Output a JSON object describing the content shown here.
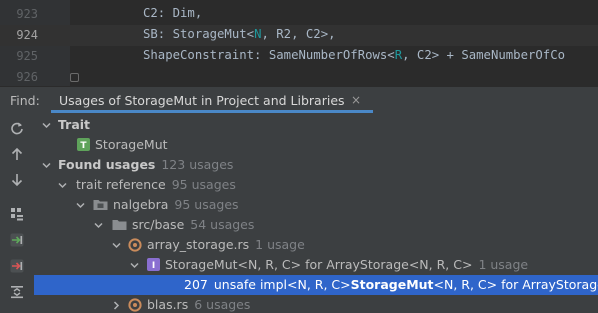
{
  "editor": {
    "lines": [
      {
        "number": "923",
        "segments": [
          {
            "text": "C2: Dim,",
            "cls": ""
          }
        ]
      },
      {
        "number": "924",
        "segments": [
          {
            "text": "SB: StorageMut<",
            "cls": ""
          },
          {
            "text": "N",
            "cls": "gen"
          },
          {
            "text": ", R2, C2>,",
            "cls": ""
          }
        ]
      },
      {
        "number": "925",
        "segments": [
          {
            "text": "ShapeConstraint: SameNumberOfRows<",
            "cls": ""
          },
          {
            "text": "R",
            "cls": "gen"
          },
          {
            "text": ", C2> + SameNumberOfCo",
            "cls": ""
          }
        ]
      },
      {
        "number": "926",
        "segments": []
      }
    ]
  },
  "find": {
    "label": "Find:",
    "tab_title": "Usages of StorageMut in Project and Libraries",
    "close_glyph": "×"
  },
  "tree": {
    "trait_header": "Trait",
    "trait_item": "StorageMut",
    "trait_icon_letter": "T",
    "found_usages": "Found usages",
    "found_usages_count": "123 usages",
    "trait_reference": "trait reference",
    "trait_reference_count": "95 usages",
    "nalgebra": "nalgebra",
    "nalgebra_count": "95 usages",
    "src_base": "src/base",
    "src_base_count": "54 usages",
    "array_storage": "array_storage.rs",
    "array_storage_count": "1 usage",
    "impl_label": "StorageMut<N, R, C> for ArrayStorage<N, R, C>",
    "impl_count": "1 usage",
    "impl_icon_letter": "I",
    "selected_line": "207",
    "selected_pre": "unsafe impl<N, R, C> ",
    "selected_bold": "StorageMut",
    "selected_post": "<N, R, C> for ArrayStorage<",
    "blas": "blas.rs",
    "blas_count": "6 usages"
  },
  "colors": {
    "selection": "#2f65ca",
    "tab_underline": "#4a88c7",
    "trait_icon": "#5fa35b",
    "impl_icon": "#8a6fd1",
    "rust_file_icon": "#c98b5c"
  }
}
